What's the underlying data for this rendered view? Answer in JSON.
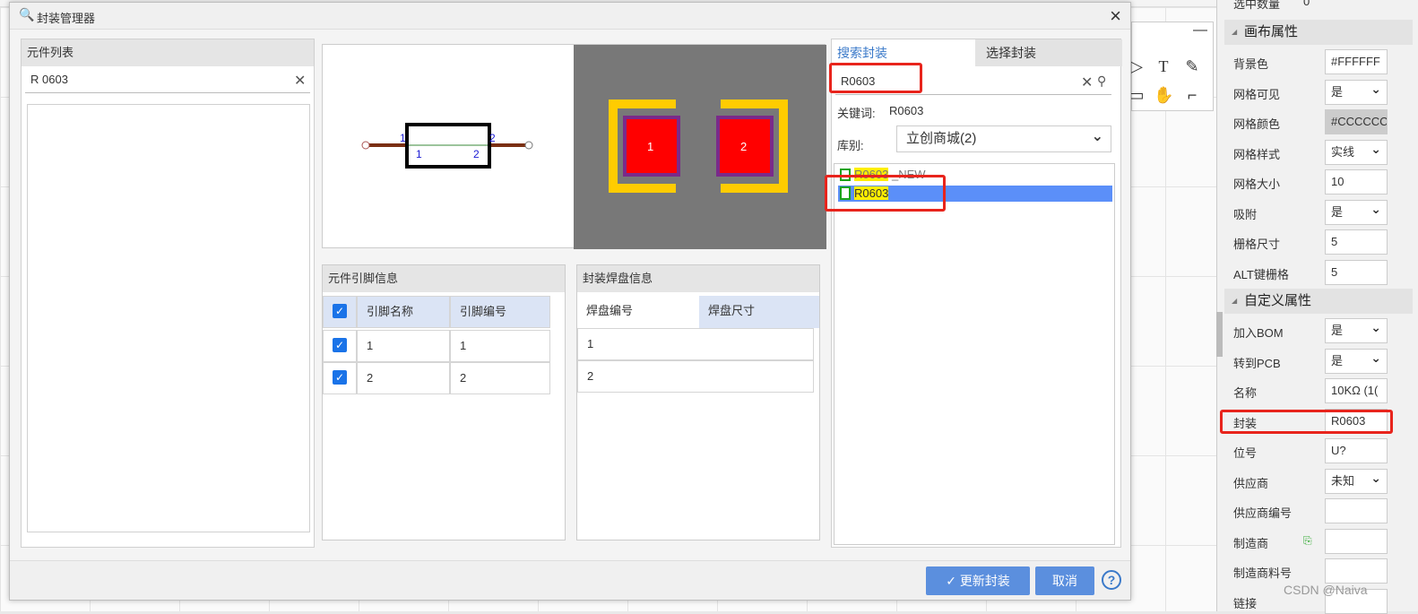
{
  "dialog": {
    "title": "封装管理器",
    "close_label": "×"
  },
  "component_list": {
    "heading": "元件列表",
    "search_value": "R 0603"
  },
  "preview": {
    "schematic_pins": [
      "1",
      "2"
    ],
    "schematic_pin_numbers": [
      "1",
      "2"
    ],
    "pads": [
      "1",
      "2"
    ]
  },
  "pin_info": {
    "heading": "元件引脚信息",
    "columns": [
      "引脚名称",
      "引脚编号"
    ],
    "rows": [
      {
        "name": "1",
        "number": "1"
      },
      {
        "name": "2",
        "number": "2"
      }
    ]
  },
  "pad_info": {
    "heading": "封装焊盘信息",
    "columns": [
      "焊盘编号",
      "焊盘尺寸"
    ],
    "rows": [
      "1",
      "2"
    ]
  },
  "search_panel": {
    "tabs": [
      "搜索封装",
      "选择封装"
    ],
    "search_value": "R0603",
    "keyword_label": "关键词:",
    "keyword_value": "R0603",
    "library_label": "库别:",
    "library_value": "立创商城(2)",
    "results": [
      {
        "name": "R0603",
        "suffix": "_NEW"
      },
      {
        "name": "R0603",
        "suffix": ""
      }
    ]
  },
  "footer": {
    "update_label": "更新封装",
    "cancel_label": "取消",
    "help_label": "?"
  },
  "properties": {
    "top_label": "选中数量",
    "top_value": "0",
    "canvas_section": "画布属性",
    "canvas_rows": [
      {
        "label": "背景色",
        "value": "#FFFFFF"
      },
      {
        "label": "网格可见",
        "value": "是"
      },
      {
        "label": "网格颜色",
        "value": "#CCCCCC"
      },
      {
        "label": "网格样式",
        "value": "实线"
      },
      {
        "label": "网格大小",
        "value": "10"
      },
      {
        "label": "吸附",
        "value": "是"
      },
      {
        "label": "栅格尺寸",
        "value": "5"
      },
      {
        "label": "ALT键栅格",
        "value": "5"
      }
    ],
    "custom_section": "自定义属性",
    "custom_rows": [
      {
        "label": "加入BOM",
        "value": "是"
      },
      {
        "label": "转到PCB",
        "value": "是"
      },
      {
        "label": "名称",
        "value": "10KΩ (1("
      },
      {
        "label": "封装",
        "value": "R0603"
      },
      {
        "label": "位号",
        "value": "U?"
      },
      {
        "label": "供应商",
        "value": "未知"
      },
      {
        "label": "供应商编号",
        "value": ""
      },
      {
        "label": "制造商",
        "value": ""
      },
      {
        "label": "制造商料号",
        "value": ""
      },
      {
        "label": "链接",
        "value": ""
      }
    ]
  },
  "watermark": "CSDN @Naiva",
  "colors": {
    "accent": "#5b8fde",
    "highlight_box": "#e8241c",
    "pad": "#ff0000",
    "pad_outline": "#ffcc00",
    "pcb_bg": "#787878"
  }
}
